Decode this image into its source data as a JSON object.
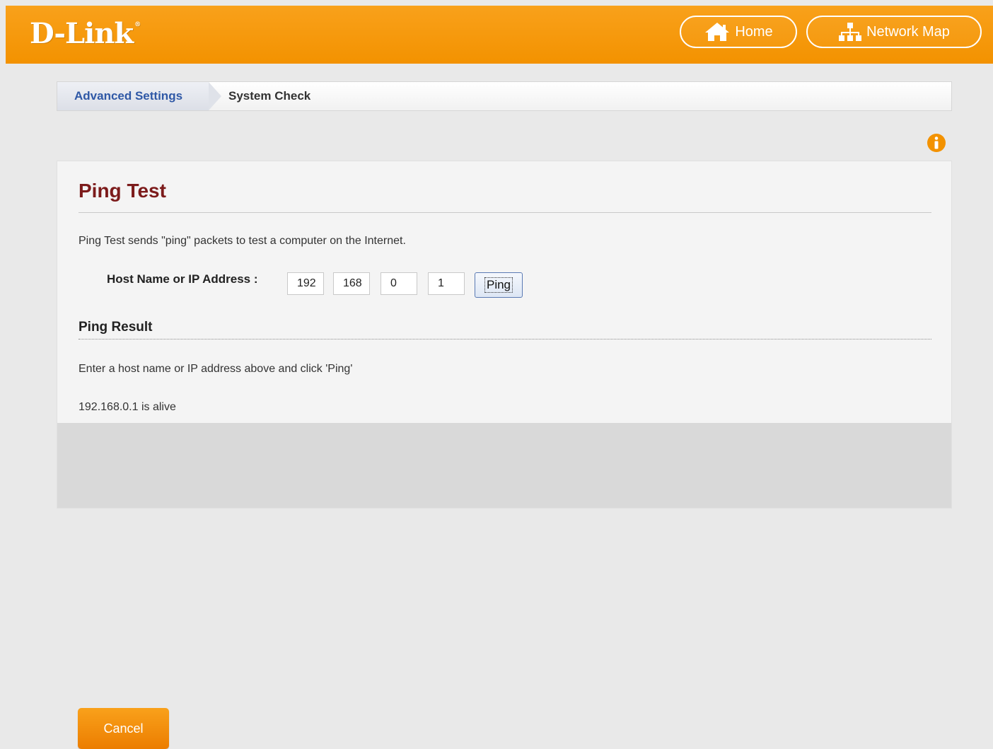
{
  "header": {
    "logo_text": "D-Link",
    "logo_mark": "®",
    "home_label": "Home",
    "home_icon": "home-icon",
    "network_map_label": "Network Map",
    "network_map_icon": "network-map-icon",
    "brand_color": "#f39200"
  },
  "breadcrumb": {
    "parent": "Advanced Settings",
    "current": "System Check"
  },
  "info_icon": "info-icon",
  "panel": {
    "title": "Ping Test",
    "description": "Ping Test sends \"ping\" packets to test a computer on the Internet.",
    "host_label": "Host Name or IP Address :",
    "ip_octets": [
      "192",
      "168",
      "0",
      "1"
    ],
    "ping_button": "Ping",
    "result_title": "Ping Result",
    "result_hint": "Enter a host name or IP address above and click 'Ping'",
    "result_status": "192.168.0.1 is alive"
  },
  "footer": {
    "cancel_label": "Cancel"
  }
}
